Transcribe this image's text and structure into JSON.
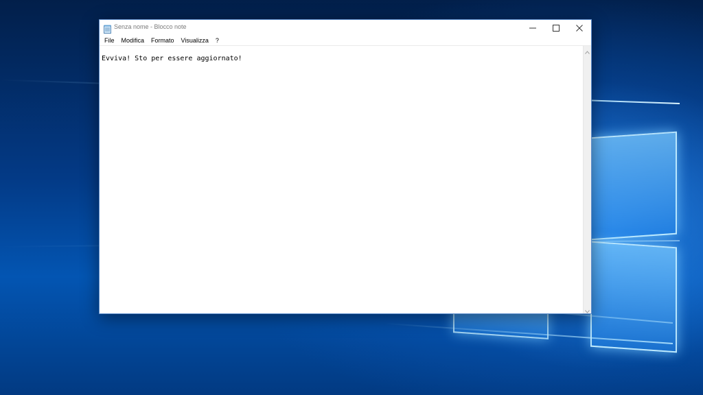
{
  "window": {
    "title": "Senza nome - Blocco note",
    "icon": "notepad-icon",
    "controls": {
      "minimize_icon": "minimize-icon",
      "maximize_icon": "maximize-icon",
      "close_icon": "close-icon"
    }
  },
  "menu": {
    "items": [
      {
        "label": "File"
      },
      {
        "label": "Modifica"
      },
      {
        "label": "Formato"
      },
      {
        "label": "Visualizza"
      },
      {
        "label": "?"
      }
    ]
  },
  "editor": {
    "content": "Evviva! Sto per essere aggiornato!"
  },
  "colors": {
    "desktop_bg": "#0355b2",
    "window_border": "#5b8ccc",
    "title_text": "#7a7a7a"
  }
}
